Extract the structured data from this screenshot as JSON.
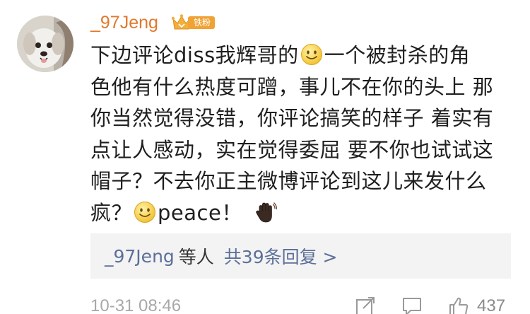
{
  "comment": {
    "username": "_97Jeng",
    "badge": {
      "label": "铁粉",
      "icon": "crown-icon"
    },
    "body_lines": [
      {
        "before": "下边评论diss我辉哥的",
        "emoji": "smile-emoji",
        "after": "一个被封杀的角"
      },
      {
        "text": "色他有什么热度可蹭，事儿不在你的头上 那"
      },
      {
        "text": "你当然觉得没错，你评论搞笑的样子 着实有"
      },
      {
        "text": "点让人感动，实在觉得委屈 要不你也试试这"
      },
      {
        "text": "帽子？不去你正主微博评论到这儿来发什么"
      },
      {
        "before": "疯？",
        "emoji": "smile-emoji",
        "after": "peace！",
        "emoji2": "waving-hand-emoji"
      }
    ],
    "replies": {
      "who": "_97Jeng",
      "mid": "等人",
      "count_text": "共39条回复 >"
    },
    "timestamp": "10-31 08:46",
    "like_count": "437"
  },
  "colors": {
    "username": "#e2782b",
    "link": "#5b6f98",
    "badge": "#f0a335",
    "meta": "#a8a8a8"
  }
}
